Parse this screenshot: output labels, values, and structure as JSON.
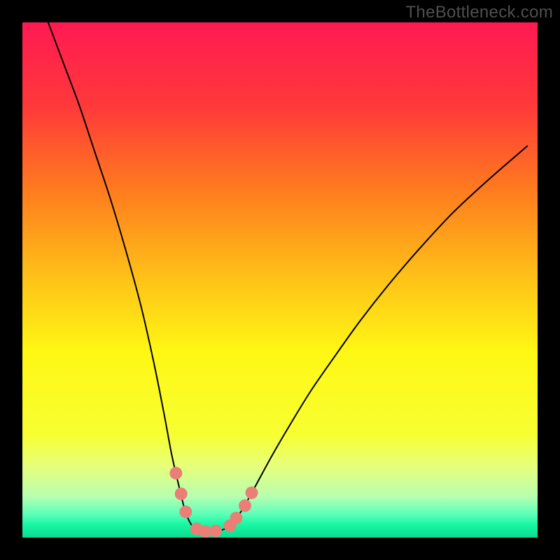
{
  "watermark": "TheBottleneck.com",
  "chart_data": {
    "type": "line",
    "title": "",
    "xlabel": "",
    "ylabel": "",
    "xlim": [
      0,
      100
    ],
    "ylim": [
      0,
      100
    ],
    "background_gradient": {
      "stops": [
        {
          "offset": 0.0,
          "color": "#ff1a52"
        },
        {
          "offset": 0.16,
          "color": "#ff383a"
        },
        {
          "offset": 0.33,
          "color": "#ff7d1e"
        },
        {
          "offset": 0.5,
          "color": "#ffc318"
        },
        {
          "offset": 0.64,
          "color": "#fff714"
        },
        {
          "offset": 0.8,
          "color": "#f7ff32"
        },
        {
          "offset": 0.86,
          "color": "#e7ff7a"
        },
        {
          "offset": 0.92,
          "color": "#b7ffb0"
        },
        {
          "offset": 0.955,
          "color": "#5bffb8"
        },
        {
          "offset": 0.975,
          "color": "#17f7a3"
        },
        {
          "offset": 1.0,
          "color": "#0bdb90"
        }
      ]
    },
    "series": [
      {
        "name": "bottleneck-curve",
        "color": "#000000",
        "stroke_width": 2,
        "x": [
          5,
          8,
          11,
          14,
          17,
          20,
          23,
          25.5,
          27.5,
          29,
          30.5,
          31.5,
          32.5,
          33.7,
          35,
          36.5,
          38,
          39.5,
          41,
          43,
          45.5,
          48.5,
          52,
          56,
          60.5,
          65.5,
          71,
          77,
          83.5,
          90.5,
          98
        ],
        "y": [
          100,
          92,
          84,
          75,
          66,
          56,
          45,
          34,
          24,
          16,
          9.5,
          5.5,
          3,
          1.5,
          1.2,
          1.2,
          1.3,
          1.8,
          3,
          6,
          10.5,
          16,
          22,
          28.5,
          35,
          42,
          49,
          56,
          63,
          69.5,
          76
        ]
      }
    ],
    "markers": [
      {
        "name": "highlight-points",
        "color": "#e97f77",
        "radius": 9,
        "points": [
          {
            "x": 29.8,
            "y": 12.5
          },
          {
            "x": 30.8,
            "y": 8.5
          },
          {
            "x": 31.7,
            "y": 5.0
          },
          {
            "x": 33.8,
            "y": 1.7
          },
          {
            "x": 35.5,
            "y": 1.2
          },
          {
            "x": 37.5,
            "y": 1.3
          },
          {
            "x": 40.3,
            "y": 2.3
          },
          {
            "x": 41.5,
            "y": 3.8
          },
          {
            "x": 43.2,
            "y": 6.2
          },
          {
            "x": 44.5,
            "y": 8.7
          }
        ]
      }
    ]
  }
}
